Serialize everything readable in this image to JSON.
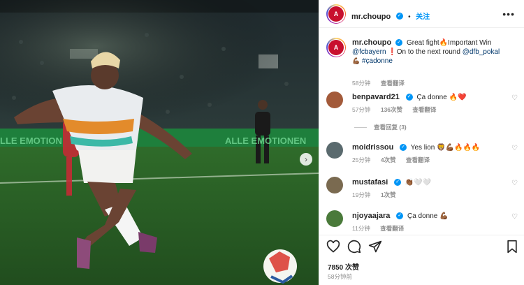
{
  "post": {
    "author": "mr.choupo",
    "follow_label": "关注",
    "more_label": "•••",
    "caption_text": "Great fight🔥Important Win",
    "caption_mention1": "@fcbayern",
    "caption_mid": "❗On to the next round",
    "caption_mention2": "@dfb_pokal",
    "caption_tag_emoji": "💪🏾",
    "caption_hashtag": "#çadonne",
    "caption_time": "58分钟",
    "caption_translate": "查看翻译",
    "likes": "7850 次赞",
    "posted_ago": "58分钟前"
  },
  "photo": {
    "banner_left": "LLE EMOTION",
    "banner_right": "ALLE EMOTIONEN",
    "next_arrow": "›"
  },
  "comments": [
    {
      "user": "benpavard21",
      "text": "Ça donne 🔥❤️",
      "time": "57分钟",
      "likes": "136次赞",
      "reply": "",
      "translate": "查看翻译",
      "replies": "查看回复 (3)",
      "avatar_color": "#a35a3a"
    },
    {
      "user": "moidrissou",
      "text": "Yes lion 🦁💪🏾🔥🔥🔥",
      "time": "25分钟",
      "likes": "4次赞",
      "reply": "回复",
      "translate": "查看翻译",
      "avatar_color": "#5a6a6e"
    },
    {
      "user": "mustafasi",
      "text": "👏🏾🤍🤍",
      "time": "19分钟",
      "likes": "1次赞",
      "reply": "",
      "translate": "",
      "avatar_color": "#7a6a50"
    },
    {
      "user": "njoyaajara",
      "text": "Ça donne 💪🏾",
      "time": "11分钟",
      "likes": "",
      "reply": "",
      "translate": "查看翻译",
      "avatar_color": "#4a7a3a"
    }
  ],
  "icons": {
    "like": "heart-icon",
    "comment": "comment-icon",
    "share": "share-icon",
    "save": "bookmark-icon"
  },
  "colors": {
    "accent": "#0095f6",
    "link": "#00376b",
    "muted": "#8e8e8e",
    "brand": "#c8102e"
  }
}
